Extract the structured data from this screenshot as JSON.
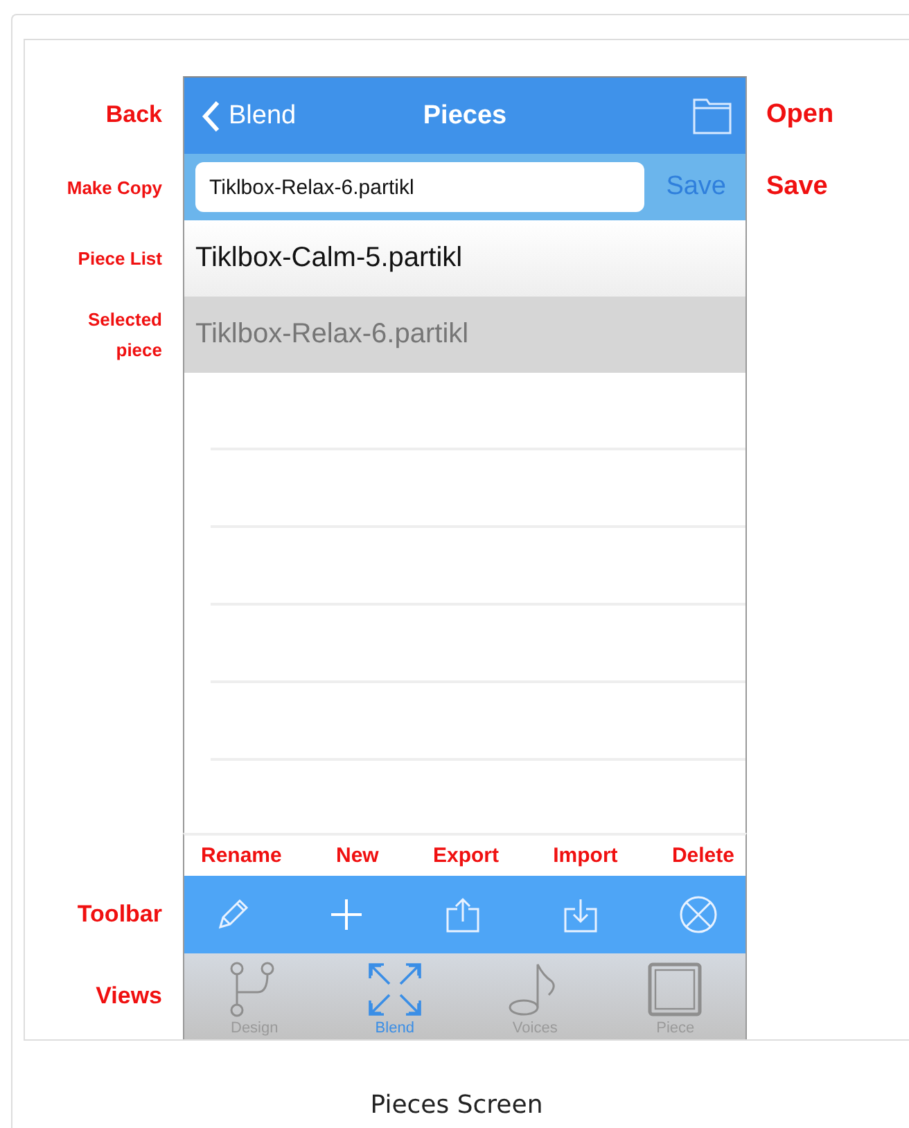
{
  "callouts": {
    "back": "Back",
    "open": "Open",
    "make_copy": "Make Copy",
    "save": "Save",
    "piece_list": "Piece List",
    "selected_piece": "Selected piece",
    "toolbar": "Toolbar",
    "views": "Views"
  },
  "nav_bar": {
    "back_label": "Blend",
    "title": "Pieces"
  },
  "copy_bar": {
    "value": "Tiklbox-Relax-6.partikl",
    "button": "Save"
  },
  "pieces": [
    {
      "name": "Tiklbox-Calm-5.partikl",
      "selected": false
    },
    {
      "name": "Tiklbox-Relax-6.partikl",
      "selected": true
    }
  ],
  "toolbar_callouts": [
    "Rename",
    "New",
    "Export",
    "Import",
    "Delete"
  ],
  "toolbar": [
    {
      "kind": "pencil"
    },
    {
      "kind": "plus"
    },
    {
      "kind": "export"
    },
    {
      "kind": "import"
    },
    {
      "kind": "delete"
    }
  ],
  "tabs": [
    {
      "label": "Design",
      "kind": "design",
      "selected": false
    },
    {
      "label": "Blend",
      "kind": "blend",
      "selected": true
    },
    {
      "label": "Voices",
      "kind": "voices",
      "selected": false
    },
    {
      "label": "Piece",
      "kind": "piece",
      "selected": false
    }
  ],
  "caption": "Pieces Screen"
}
